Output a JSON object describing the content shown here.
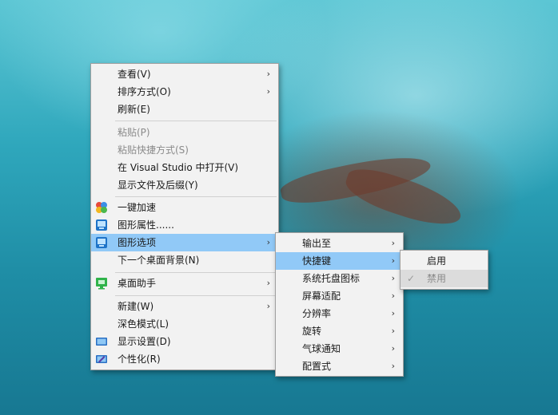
{
  "context_menu": {
    "items": [
      {
        "label": "查看(V)",
        "submenu": true
      },
      {
        "label": "排序方式(O)",
        "submenu": true
      },
      {
        "label": "刷新(E)"
      },
      {
        "label": "粘贴(P)",
        "disabled": true
      },
      {
        "label": "粘贴快捷方式(S)",
        "disabled": true
      },
      {
        "label": "在 Visual Studio 中打开(V)"
      },
      {
        "label": "显示文件及后缀(Y)"
      },
      {
        "label": "一键加速",
        "icon": "speedup-icon"
      },
      {
        "label": "图形属性......",
        "icon": "graphics-properties-icon"
      },
      {
        "label": "图形选项",
        "icon": "graphics-options-icon",
        "submenu": true,
        "highlighted": true
      },
      {
        "label": "下一个桌面背景(N)"
      },
      {
        "label": "桌面助手",
        "icon": "desktop-assistant-icon",
        "submenu": true
      },
      {
        "label": "新建(W)",
        "submenu": true
      },
      {
        "label": "深色模式(L)"
      },
      {
        "label": "显示设置(D)",
        "icon": "display-settings-icon"
      },
      {
        "label": "个性化(R)",
        "icon": "personalize-icon"
      }
    ]
  },
  "graphics_options_submenu": {
    "items": [
      {
        "label": "输出至"
      },
      {
        "label": "快捷键",
        "highlighted": true
      },
      {
        "label": "系统托盘图标"
      },
      {
        "label": "屏幕适配"
      },
      {
        "label": "分辨率"
      },
      {
        "label": "旋转"
      },
      {
        "label": "气球通知"
      },
      {
        "label": "配置式"
      }
    ]
  },
  "hotkey_submenu": {
    "items": [
      {
        "label": "启用"
      },
      {
        "label": "禁用",
        "checked": true,
        "disabled": true
      }
    ]
  },
  "glyphs": {
    "arrow": "›",
    "check": "✓"
  },
  "colors": {
    "highlight": "#91c9f7",
    "menu_bg": "#f2f2f2",
    "disabled_text": "#8a8a8a"
  }
}
